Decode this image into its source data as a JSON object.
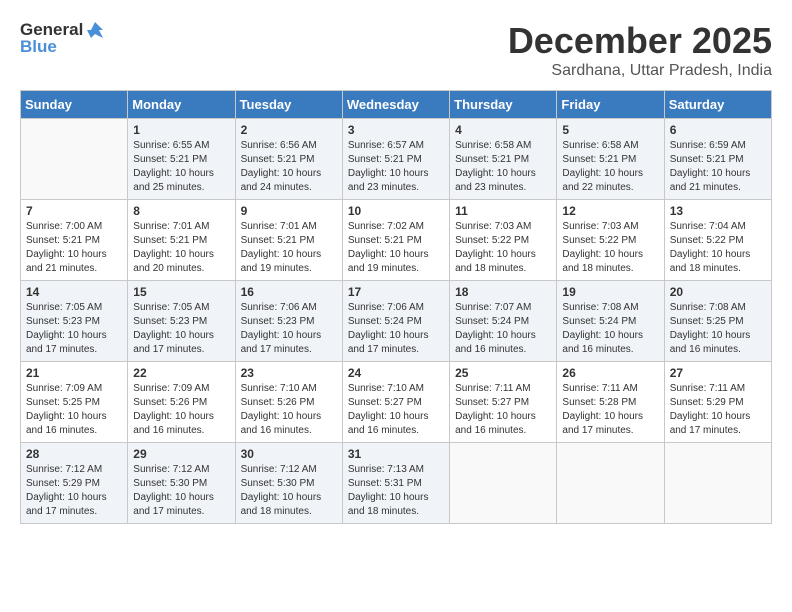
{
  "header": {
    "logo_general": "General",
    "logo_blue": "Blue",
    "month": "December 2025",
    "location": "Sardhana, Uttar Pradesh, India"
  },
  "days_of_week": [
    "Sunday",
    "Monday",
    "Tuesday",
    "Wednesday",
    "Thursday",
    "Friday",
    "Saturday"
  ],
  "weeks": [
    [
      {
        "day": "",
        "sunrise": "",
        "sunset": "",
        "daylight": ""
      },
      {
        "day": "1",
        "sunrise": "6:55 AM",
        "sunset": "5:21 PM",
        "daylight": "10 hours and 25 minutes."
      },
      {
        "day": "2",
        "sunrise": "6:56 AM",
        "sunset": "5:21 PM",
        "daylight": "10 hours and 24 minutes."
      },
      {
        "day": "3",
        "sunrise": "6:57 AM",
        "sunset": "5:21 PM",
        "daylight": "10 hours and 23 minutes."
      },
      {
        "day": "4",
        "sunrise": "6:58 AM",
        "sunset": "5:21 PM",
        "daylight": "10 hours and 23 minutes."
      },
      {
        "day": "5",
        "sunrise": "6:58 AM",
        "sunset": "5:21 PM",
        "daylight": "10 hours and 22 minutes."
      },
      {
        "day": "6",
        "sunrise": "6:59 AM",
        "sunset": "5:21 PM",
        "daylight": "10 hours and 21 minutes."
      }
    ],
    [
      {
        "day": "7",
        "sunrise": "7:00 AM",
        "sunset": "5:21 PM",
        "daylight": "10 hours and 21 minutes."
      },
      {
        "day": "8",
        "sunrise": "7:01 AM",
        "sunset": "5:21 PM",
        "daylight": "10 hours and 20 minutes."
      },
      {
        "day": "9",
        "sunrise": "7:01 AM",
        "sunset": "5:21 PM",
        "daylight": "10 hours and 19 minutes."
      },
      {
        "day": "10",
        "sunrise": "7:02 AM",
        "sunset": "5:21 PM",
        "daylight": "10 hours and 19 minutes."
      },
      {
        "day": "11",
        "sunrise": "7:03 AM",
        "sunset": "5:22 PM",
        "daylight": "10 hours and 18 minutes."
      },
      {
        "day": "12",
        "sunrise": "7:03 AM",
        "sunset": "5:22 PM",
        "daylight": "10 hours and 18 minutes."
      },
      {
        "day": "13",
        "sunrise": "7:04 AM",
        "sunset": "5:22 PM",
        "daylight": "10 hours and 18 minutes."
      }
    ],
    [
      {
        "day": "14",
        "sunrise": "7:05 AM",
        "sunset": "5:23 PM",
        "daylight": "10 hours and 17 minutes."
      },
      {
        "day": "15",
        "sunrise": "7:05 AM",
        "sunset": "5:23 PM",
        "daylight": "10 hours and 17 minutes."
      },
      {
        "day": "16",
        "sunrise": "7:06 AM",
        "sunset": "5:23 PM",
        "daylight": "10 hours and 17 minutes."
      },
      {
        "day": "17",
        "sunrise": "7:06 AM",
        "sunset": "5:24 PM",
        "daylight": "10 hours and 17 minutes."
      },
      {
        "day": "18",
        "sunrise": "7:07 AM",
        "sunset": "5:24 PM",
        "daylight": "10 hours and 16 minutes."
      },
      {
        "day": "19",
        "sunrise": "7:08 AM",
        "sunset": "5:24 PM",
        "daylight": "10 hours and 16 minutes."
      },
      {
        "day": "20",
        "sunrise": "7:08 AM",
        "sunset": "5:25 PM",
        "daylight": "10 hours and 16 minutes."
      }
    ],
    [
      {
        "day": "21",
        "sunrise": "7:09 AM",
        "sunset": "5:25 PM",
        "daylight": "10 hours and 16 minutes."
      },
      {
        "day": "22",
        "sunrise": "7:09 AM",
        "sunset": "5:26 PM",
        "daylight": "10 hours and 16 minutes."
      },
      {
        "day": "23",
        "sunrise": "7:10 AM",
        "sunset": "5:26 PM",
        "daylight": "10 hours and 16 minutes."
      },
      {
        "day": "24",
        "sunrise": "7:10 AM",
        "sunset": "5:27 PM",
        "daylight": "10 hours and 16 minutes."
      },
      {
        "day": "25",
        "sunrise": "7:11 AM",
        "sunset": "5:27 PM",
        "daylight": "10 hours and 16 minutes."
      },
      {
        "day": "26",
        "sunrise": "7:11 AM",
        "sunset": "5:28 PM",
        "daylight": "10 hours and 17 minutes."
      },
      {
        "day": "27",
        "sunrise": "7:11 AM",
        "sunset": "5:29 PM",
        "daylight": "10 hours and 17 minutes."
      }
    ],
    [
      {
        "day": "28",
        "sunrise": "7:12 AM",
        "sunset": "5:29 PM",
        "daylight": "10 hours and 17 minutes."
      },
      {
        "day": "29",
        "sunrise": "7:12 AM",
        "sunset": "5:30 PM",
        "daylight": "10 hours and 17 minutes."
      },
      {
        "day": "30",
        "sunrise": "7:12 AM",
        "sunset": "5:30 PM",
        "daylight": "10 hours and 18 minutes."
      },
      {
        "day": "31",
        "sunrise": "7:13 AM",
        "sunset": "5:31 PM",
        "daylight": "10 hours and 18 minutes."
      },
      {
        "day": "",
        "sunrise": "",
        "sunset": "",
        "daylight": ""
      },
      {
        "day": "",
        "sunrise": "",
        "sunset": "",
        "daylight": ""
      },
      {
        "day": "",
        "sunrise": "",
        "sunset": "",
        "daylight": ""
      }
    ]
  ],
  "labels": {
    "sunrise_prefix": "Sunrise: ",
    "sunset_prefix": "Sunset: ",
    "daylight_prefix": "Daylight: "
  }
}
